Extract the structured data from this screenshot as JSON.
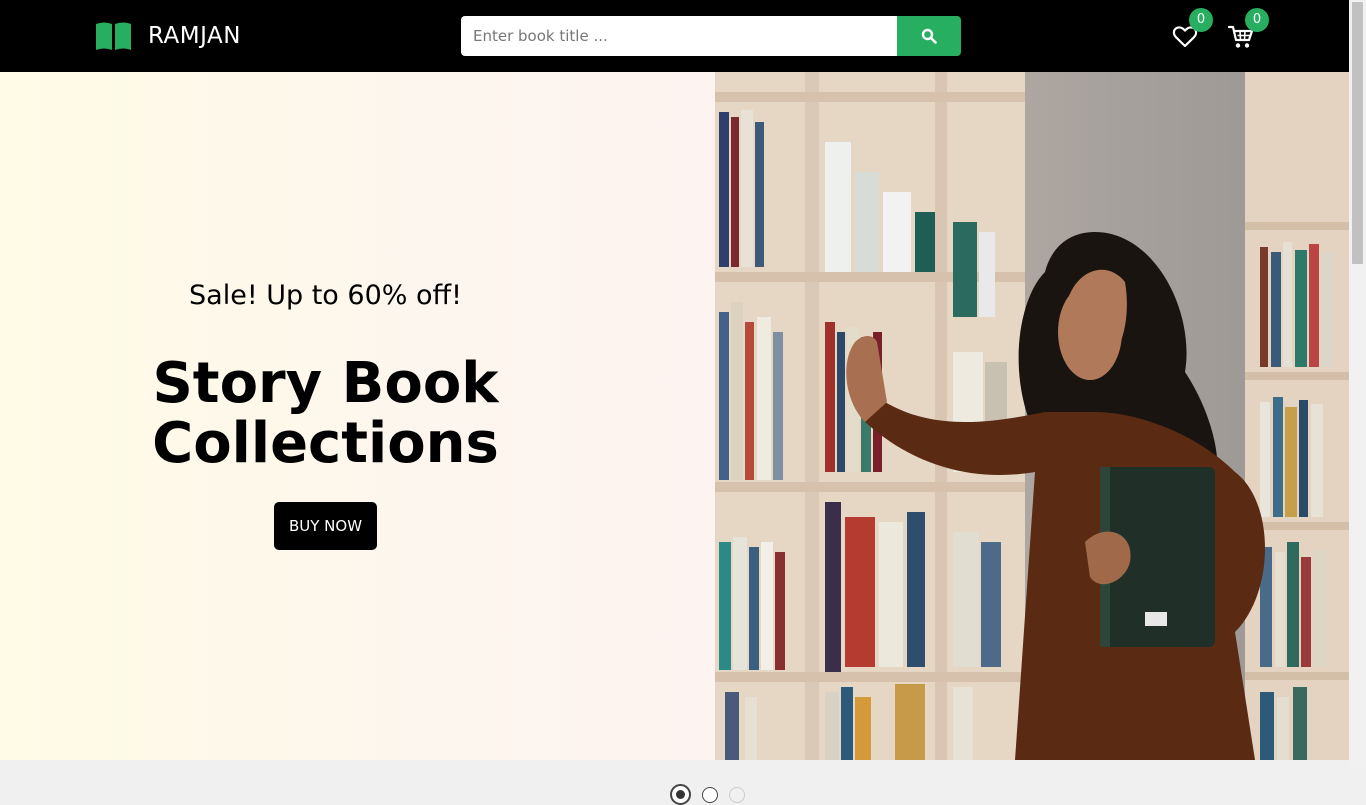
{
  "header": {
    "brand_name": "RAMJAN",
    "brand_icon": "open-book-icon",
    "search": {
      "placeholder": "Enter book title ...",
      "value": "",
      "button_icon": "search-icon"
    },
    "wishlist": {
      "icon": "heart-icon",
      "count": "0"
    },
    "cart": {
      "icon": "cart-icon",
      "count": "0"
    }
  },
  "hero": {
    "subtitle": "Sale! Up to 60% off!",
    "title": "Story Book Collections",
    "button_label": "BUY NOW",
    "slides": {
      "count": 3,
      "active": 1
    }
  },
  "colors": {
    "navbar": "#000000",
    "accent": "#27ae60",
    "hero_bg": "#fffbe6",
    "button": "#000000"
  }
}
